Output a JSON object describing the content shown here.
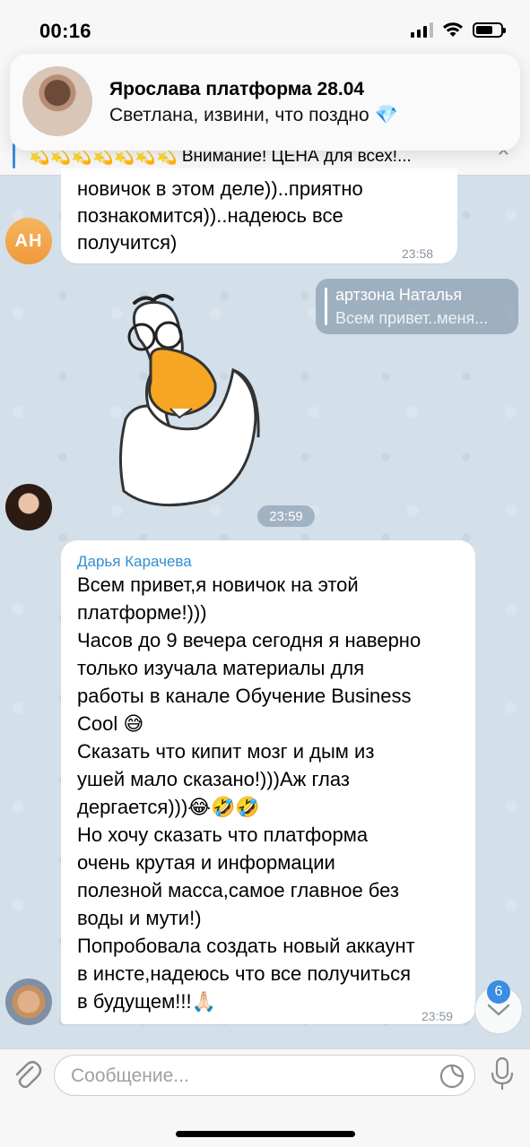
{
  "status_bar": {
    "time": "00:16"
  },
  "notification": {
    "title": "Ярослава платформа 28.04",
    "body": "Светлана, извини, что поздно",
    "emoji": "💎"
  },
  "pinned": {
    "text": "💫💫💫💫💫💫💫 Внимание! ЦЕНА для всех!..."
  },
  "messages": [
    {
      "avatar_text": "АН",
      "text": "новичок в этом деле))..приятно\nпознакомится))..надеюсь все\nполучится)",
      "time": "23:58"
    },
    {
      "reply_name": "артзона Наталья",
      "reply_text": "Всем привет..меня...",
      "time": "23:59"
    },
    {
      "sender": "Дарья Карачева",
      "text": "Всем привет,я новичок на этой\nплатформе!)))\nЧасов до 9 вечера сегодня я наверно\nтолько изучала материалы для\nработы в канале Обучение Business\nCool 😅\nСказать что кипит мозг и дым из\nушей мало сказано!)))Аж глаз\nдергается)))😂🤣🤣\nНо хочу сказать что платформа\nочень крутая и информации\nполезной масса,самое главное без\nводы и мути!)\nПопробовала создать новый аккаунт\nв инсте,надеюсь что все получиться\nв будущем!!!🙏🏻",
      "time": "23:59"
    }
  ],
  "scroll_badge": "6",
  "input": {
    "placeholder": "Сообщение..."
  },
  "colors": {
    "accent": "#3a8de0",
    "sender_name": "#2f8fd1"
  }
}
